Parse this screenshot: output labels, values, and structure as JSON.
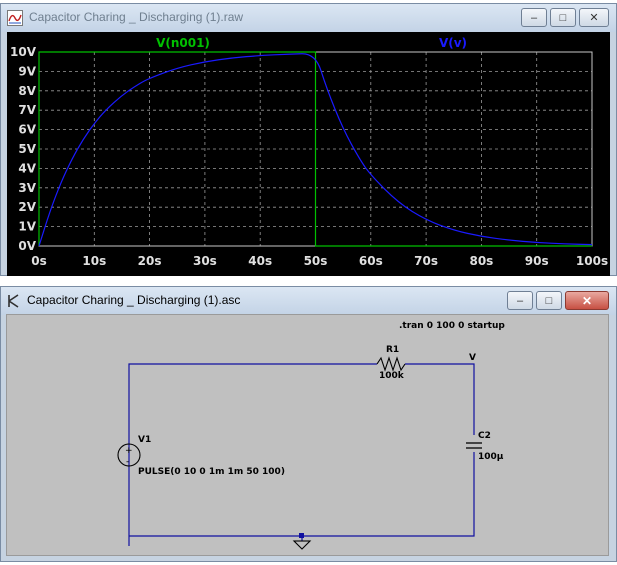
{
  "waveform_window": {
    "title": "Capacitor Charing _ Discharging  (1).raw",
    "trace_labels": [
      "V(n001)",
      "V(v)"
    ],
    "trace_colors": {
      "v_n001": "#00c000",
      "v_v": "#1a1aff"
    }
  },
  "schematic_window": {
    "title": "Capacitor Charing _ Discharging  (1).asc",
    "directive": ".tran 0 100 0 startup",
    "r1_name": "R1",
    "r1_value": "100k",
    "node_label": "V",
    "v1_name": "V1",
    "v1_value": "PULSE(0 10 0 1m 1m 50 100)",
    "c2_name": "C2",
    "c2_value": "100µ"
  },
  "chart_data": {
    "type": "line",
    "xlabel": "",
    "ylabel": "",
    "x_ticks": [
      "0s",
      "10s",
      "20s",
      "30s",
      "40s",
      "50s",
      "60s",
      "70s",
      "80s",
      "90s",
      "100s"
    ],
    "y_ticks": [
      "0V",
      "1V",
      "2V",
      "3V",
      "4V",
      "5V",
      "6V",
      "7V",
      "8V",
      "9V",
      "10V"
    ],
    "xlim": [
      0,
      100
    ],
    "ylim": [
      0,
      10
    ],
    "grid": true,
    "series": [
      {
        "name": "V(n001)",
        "x": [
          0,
          0.001,
          50,
          50.001,
          100
        ],
        "y": [
          0,
          10,
          10,
          0,
          0
        ]
      },
      {
        "name": "V(v)",
        "x": [
          0,
          2,
          4,
          6,
          8,
          10,
          12,
          15,
          18,
          20,
          25,
          30,
          35,
          40,
          45,
          50,
          52,
          55,
          58,
          60,
          65,
          70,
          75,
          80,
          85,
          90,
          95,
          100
        ],
        "y": [
          0,
          1.81,
          3.3,
          4.51,
          5.51,
          6.32,
          6.99,
          7.77,
          8.35,
          8.65,
          9.18,
          9.5,
          9.7,
          9.82,
          9.89,
          9.93,
          8.13,
          6.02,
          4.46,
          3.65,
          2.22,
          1.34,
          0.81,
          0.49,
          0.3,
          0.18,
          0.11,
          0.07
        ]
      }
    ]
  }
}
